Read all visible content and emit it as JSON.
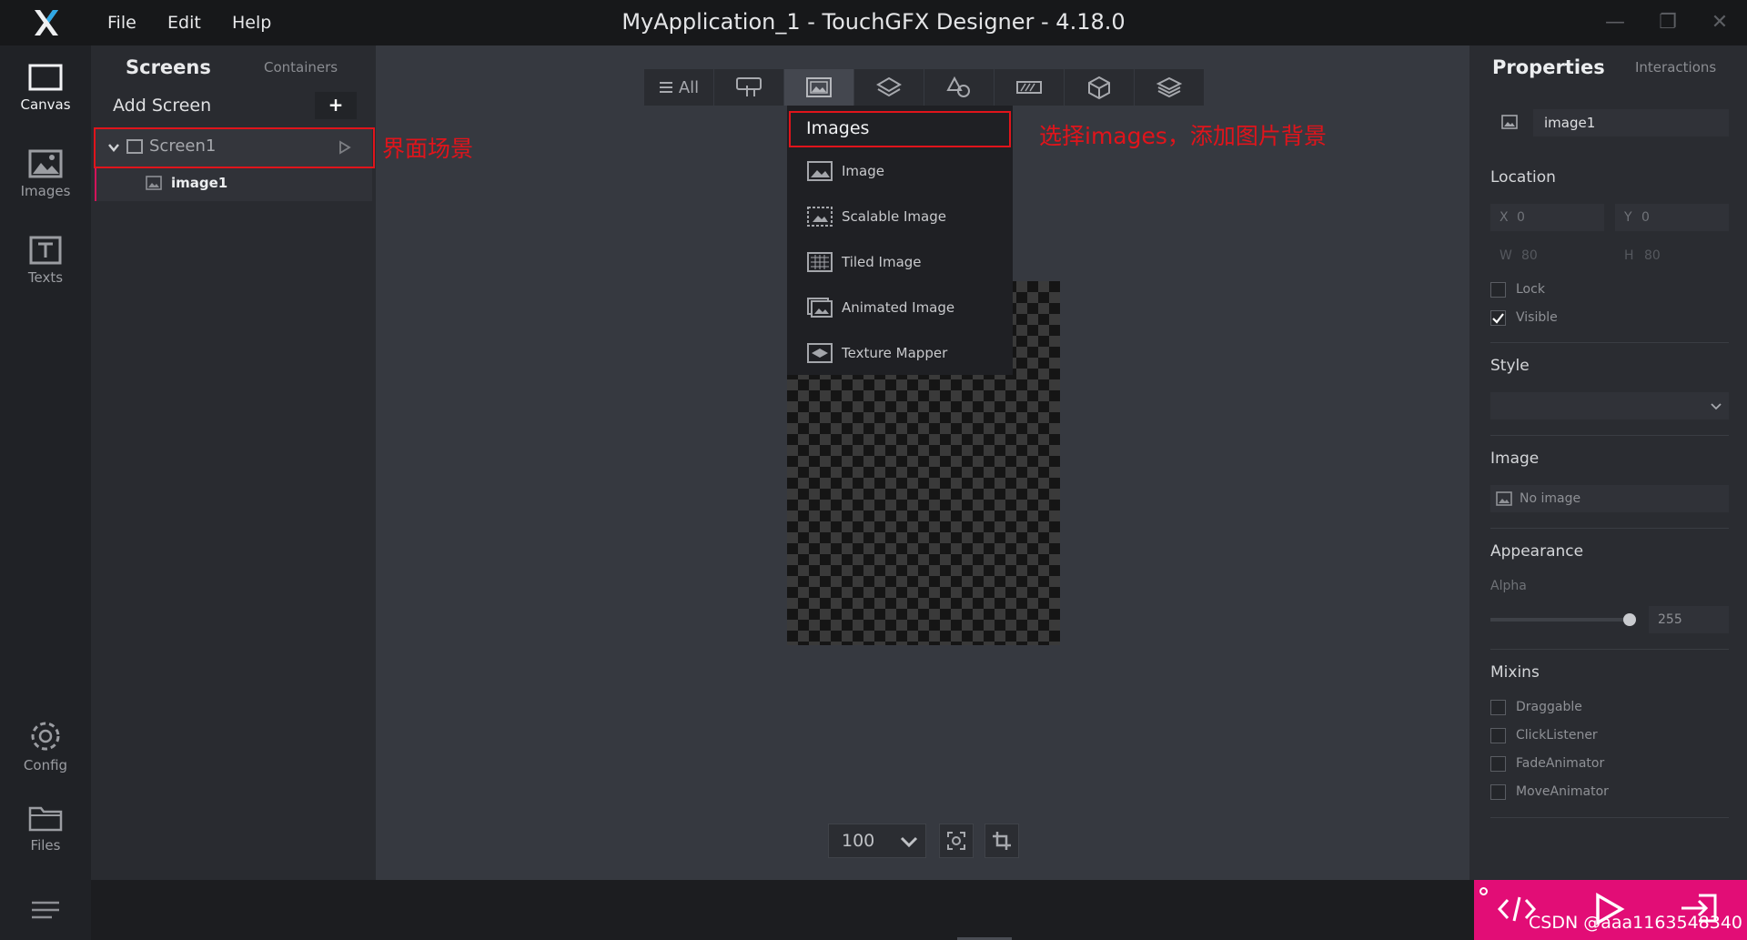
{
  "window": {
    "title": "MyApplication_1 - TouchGFX Designer - 4.18.0",
    "menus": [
      "File",
      "Edit",
      "Help"
    ]
  },
  "rail": {
    "items": [
      {
        "label": "Canvas",
        "icon": "canvas-icon"
      },
      {
        "label": "Images",
        "icon": "images-icon"
      },
      {
        "label": "Texts",
        "icon": "texts-icon"
      },
      {
        "label": "Config",
        "icon": "gear-icon"
      },
      {
        "label": "Files",
        "icon": "folder-icon"
      }
    ]
  },
  "tree": {
    "tab_screens": "Screens",
    "tab_containers": "Containers",
    "add_screen": "Add Screen",
    "add_symbol": "+",
    "screen_name": "Screen1",
    "child_name": "image1"
  },
  "toolbar": {
    "all_label": "All",
    "icons": [
      "hand-icon",
      "image-icon",
      "layers-icon",
      "shapes-icon",
      "progress-icon",
      "cube-icon",
      "stack-icon"
    ]
  },
  "dropdown": {
    "header": "Images",
    "items": [
      "Image",
      "Scalable Image",
      "Tiled Image",
      "Animated Image",
      "Texture Mapper"
    ]
  },
  "zoom": {
    "value": "100"
  },
  "properties": {
    "title": "Properties",
    "tab_interactions": "Interactions",
    "widget_name": "image1",
    "location_label": "Location",
    "x_label": "X",
    "x_value": "0",
    "y_label": "Y",
    "y_value": "0",
    "w_label": "W",
    "w_value": "80",
    "h_label": "H",
    "h_value": "80",
    "lock_label": "Lock",
    "visible_label": "Visible",
    "style_label": "Style",
    "image_label": "Image",
    "no_image": "No image",
    "appearance_label": "Appearance",
    "alpha_label": "Alpha",
    "alpha_value": "255",
    "mixins_label": "Mixins",
    "mixins": [
      "Draggable",
      "ClickListener",
      "FadeAnimator",
      "MoveAnimator"
    ]
  },
  "annotations": {
    "screen_note": "界面场景",
    "images_note": "选择images，添加图片背景"
  },
  "watermark": "CSDN @aaa1163548340",
  "colors": {
    "accent": "#e20d76",
    "annotation": "#e0141b"
  }
}
